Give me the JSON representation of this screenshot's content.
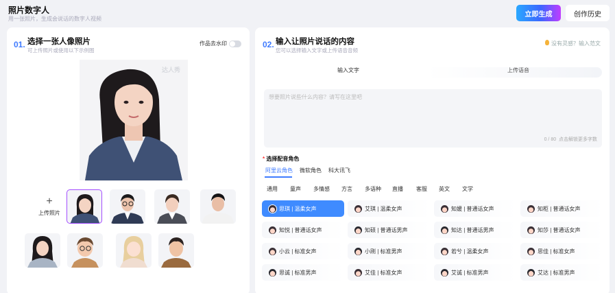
{
  "header": {
    "title": "照片数字人",
    "subtitle": "用一张照片，生成会说话的数字人视频",
    "generate_label": "立即生成",
    "history_label": "创作历史"
  },
  "left": {
    "step_num": "01.",
    "title": "选择一张人像照片",
    "subtitle": "可上传照片或使用以下示例图",
    "watermark_label": "作品去水印",
    "watermark_on": false,
    "photo_watermark": "达人秀",
    "upload_icon": "plus-icon",
    "upload_label": "上传照片",
    "thumbnails": [
      "woman-blazer",
      "man-glasses",
      "woman-suit",
      "man-tshirt",
      "woman-casual",
      "cartoon-boy",
      "cartoon-girl",
      "cartoon-man"
    ],
    "selected_thumbnail": 0
  },
  "right": {
    "step_num": "02.",
    "title": "输入让照片说话的内容",
    "subtitle": "您可以选择输入文字或上传语音音频",
    "hint": "没有灵感？输入范文",
    "hint_icon": "lightbulb-icon",
    "mode_tabs": [
      "输入文字",
      "上传语音"
    ],
    "text_placeholder": "想要照片说些什么内容？请写在这里吧",
    "char_counter": "0 / 80",
    "counter_hint": "点击解锁更多字数",
    "voice_section_label": "选择配音角色",
    "required_mark": "*",
    "voice_sources": [
      "阿里云角色",
      "微软角色",
      "科大讯飞"
    ],
    "active_source": 0,
    "categories": [
      "通用",
      "童声",
      "多情感",
      "方言",
      "多语种",
      "直播",
      "客服",
      "英文",
      "文学"
    ],
    "voices": [
      [
        "思琪 | 温柔女声",
        "艾琪 | 温柔女声",
        "知媛 | 普通话女声",
        "知柜 | 普通话女声"
      ],
      [
        "知悦 | 普通话女声",
        "知硕 | 普通话男声",
        "知达 | 普通话男声",
        "知莎 | 普通话女声"
      ],
      [
        "小云 | 标准女声",
        "小刚 | 标准男声",
        "若兮 | 温柔女声",
        "思佳 | 标准女声"
      ],
      [
        "思诚 | 标准男声",
        "艾佳 | 标准女声",
        "艾诚 | 标准男声",
        "艾达 | 标准男声"
      ]
    ],
    "voice_genders": [
      [
        "f",
        "f",
        "f",
        "f"
      ],
      [
        "f",
        "m",
        "m",
        "f"
      ],
      [
        "f",
        "m",
        "f",
        "f"
      ],
      [
        "m",
        "f",
        "m",
        "m"
      ]
    ],
    "selected_voice": 0
  },
  "colors": {
    "accent": "#3f7bff",
    "gen_start": "#2aa8ff",
    "gen_end": "#c03dff",
    "bg": "#f1f2f6"
  }
}
